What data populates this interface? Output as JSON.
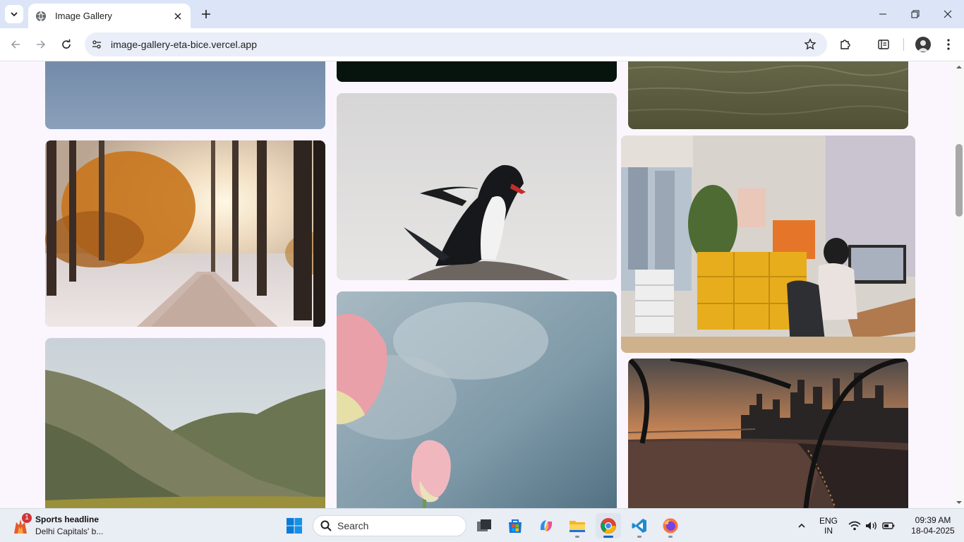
{
  "browser": {
    "tab_title": "Image Gallery",
    "url": "image-gallery-eta-bice.vercel.app",
    "icons": {
      "tab_search": "chevron-down-icon",
      "favicon": "globe-icon",
      "tab_close": "close-icon",
      "new_tab": "plus-icon",
      "minimize": "minimize-icon",
      "maximize": "restore-icon",
      "close_window": "close-icon",
      "back": "back-arrow-icon",
      "forward": "forward-arrow-icon",
      "reload": "reload-icon",
      "site_info": "tune-icon",
      "bookmark": "star-icon",
      "extensions": "puzzle-icon",
      "reading_list": "side-panel-icon",
      "profile": "avatar-icon",
      "menu": "more-vert-icon"
    }
  },
  "gallery": {
    "columns": 3,
    "images": [
      {
        "id": "sky-top",
        "subject": "blue sky"
      },
      {
        "id": "dark-top",
        "subject": "dark image"
      },
      {
        "id": "water-top",
        "subject": "green water"
      },
      {
        "id": "forest",
        "subject": "autumn forest road with snow"
      },
      {
        "id": "penguin",
        "subject": "penguin on rock"
      },
      {
        "id": "office",
        "subject": "home office with yellow cabinets"
      },
      {
        "id": "hills",
        "subject": "green hills valley"
      },
      {
        "id": "tulips",
        "subject": "pink tulips against sky"
      },
      {
        "id": "city",
        "subject": "city skyline at sunset"
      }
    ]
  },
  "taskbar": {
    "news_badge": "1",
    "news_title": "Sports headline",
    "news_sub": "Delhi Capitals' b...",
    "search_placeholder": "Search",
    "lang_line1": "ENG",
    "lang_line2": "IN",
    "time": "09:39 AM",
    "date": "18-04-2025",
    "apps": [
      "windows-start",
      "task-view",
      "microsoft-store",
      "copilot",
      "file-explorer",
      "chrome",
      "vscode",
      "firefox"
    ],
    "tray_icons": [
      "chevron-up-icon",
      "wifi-icon",
      "volume-icon",
      "battery-icon"
    ]
  }
}
